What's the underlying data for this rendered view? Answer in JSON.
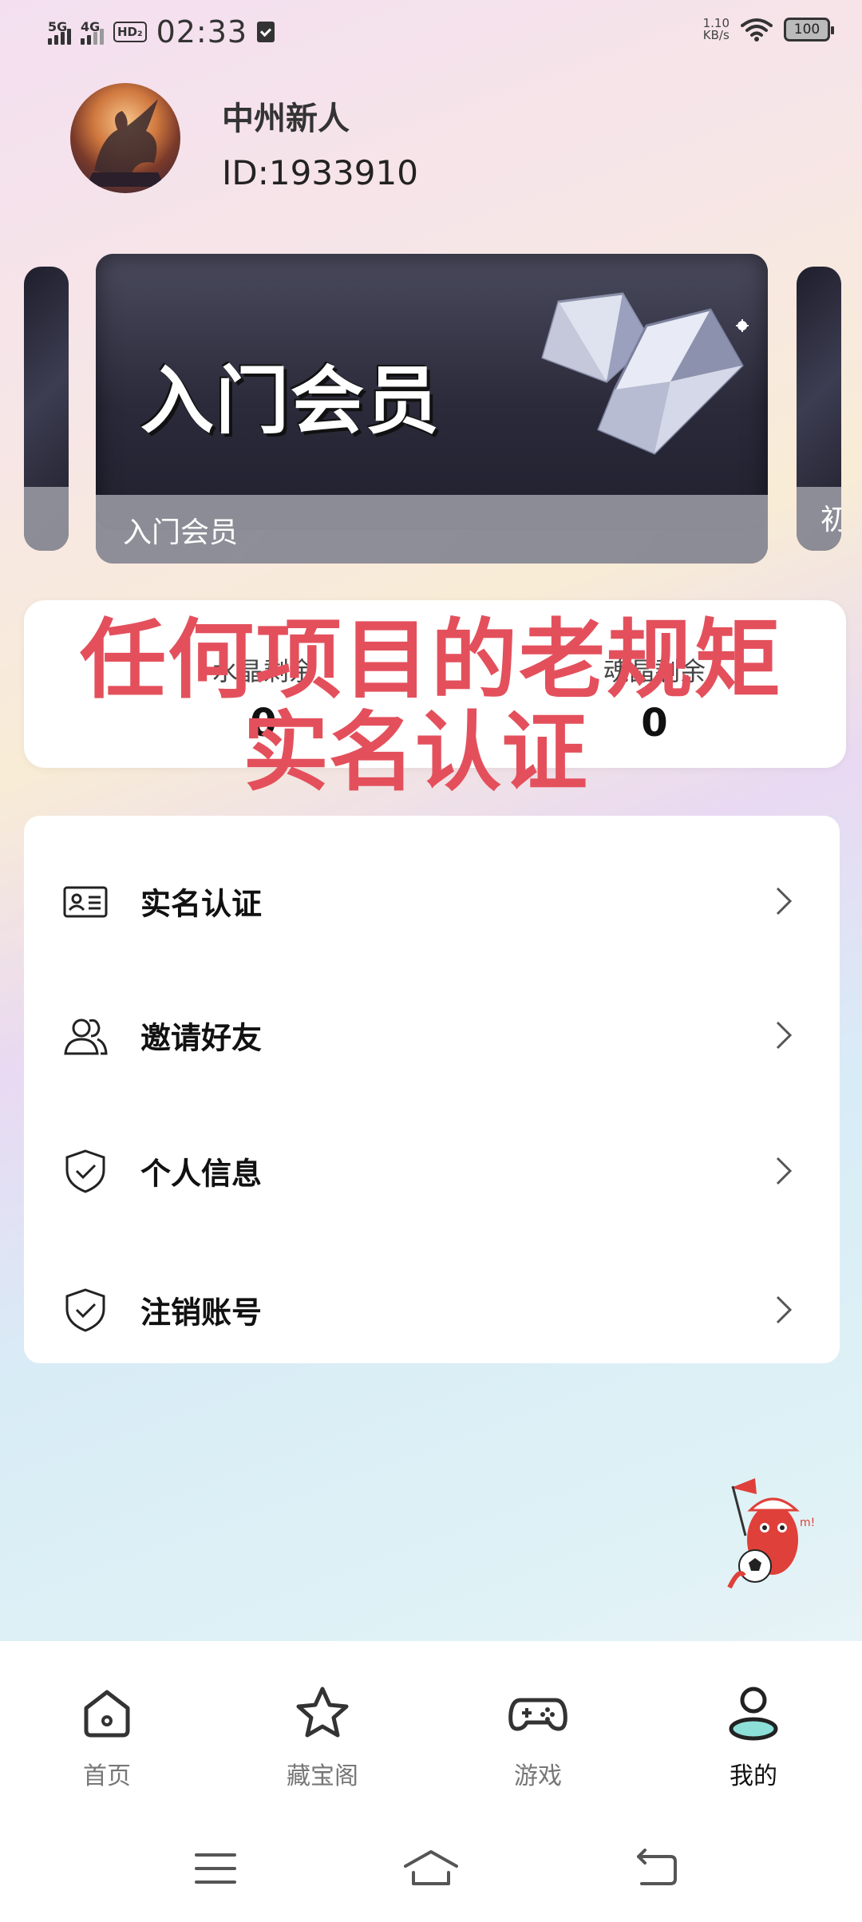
{
  "status_bar": {
    "signal_1": "5G",
    "signal_2": "4G",
    "hd_badge": "HD₂",
    "time": "02:33",
    "net_speed_value": "1.10",
    "net_speed_unit": "KB/s",
    "battery": "100"
  },
  "profile": {
    "username": "中州新人",
    "user_id": "ID:1933910"
  },
  "carousel": {
    "main_banner_text": "入门会员",
    "main_label": "入门会员",
    "right_label": "初"
  },
  "stats": {
    "left_label": "水晶剩余",
    "left_value": "0",
    "right_label": "魂晶剩余",
    "right_value": "0"
  },
  "overlay": {
    "line1": "任何项目的老规矩",
    "line2": "实名认证"
  },
  "menu": {
    "items": [
      {
        "label": "实名认证",
        "icon": "id-card-icon"
      },
      {
        "label": "邀请好友",
        "icon": "users-icon"
      },
      {
        "label": "个人信息",
        "icon": "shield-check-icon"
      },
      {
        "label": "注销账号",
        "icon": "shield-check-icon"
      }
    ]
  },
  "bottom_nav": {
    "items": [
      {
        "label": "首页",
        "icon": "home-icon"
      },
      {
        "label": "藏宝阁",
        "icon": "star-icon"
      },
      {
        "label": "游戏",
        "icon": "gamepad-icon"
      },
      {
        "label": "我的",
        "icon": "user-icon",
        "active": true
      }
    ]
  },
  "colors": {
    "overlay_red": "#e3505c",
    "active_accent": "#8de0d8"
  }
}
